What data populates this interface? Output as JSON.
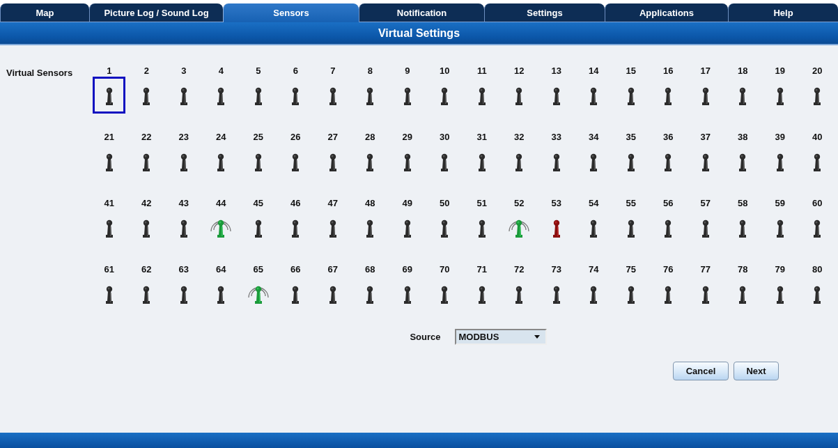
{
  "tabs": [
    {
      "label": "Map",
      "selected": false
    },
    {
      "label": "Picture Log / Sound Log",
      "selected": false
    },
    {
      "label": "Sensors",
      "selected": true
    },
    {
      "label": "Notification",
      "selected": false
    },
    {
      "label": "Settings",
      "selected": false
    },
    {
      "label": "Applications",
      "selected": false
    },
    {
      "label": "Help",
      "selected": false
    }
  ],
  "page_title": "Virtual Settings",
  "sensors_label": "Virtual Sensors",
  "sensors": [
    {
      "number": "1",
      "kind": "off",
      "selected": true
    },
    {
      "number": "2",
      "kind": "off",
      "selected": false
    },
    {
      "number": "3",
      "kind": "off",
      "selected": false
    },
    {
      "number": "4",
      "kind": "off",
      "selected": false
    },
    {
      "number": "5",
      "kind": "off",
      "selected": false
    },
    {
      "number": "6",
      "kind": "off",
      "selected": false
    },
    {
      "number": "7",
      "kind": "off",
      "selected": false
    },
    {
      "number": "8",
      "kind": "off",
      "selected": false
    },
    {
      "number": "9",
      "kind": "off",
      "selected": false
    },
    {
      "number": "10",
      "kind": "off",
      "selected": false
    },
    {
      "number": "11",
      "kind": "off",
      "selected": false
    },
    {
      "number": "12",
      "kind": "off",
      "selected": false
    },
    {
      "number": "13",
      "kind": "off",
      "selected": false
    },
    {
      "number": "14",
      "kind": "off",
      "selected": false
    },
    {
      "number": "15",
      "kind": "off",
      "selected": false
    },
    {
      "number": "16",
      "kind": "off",
      "selected": false
    },
    {
      "number": "17",
      "kind": "off",
      "selected": false
    },
    {
      "number": "18",
      "kind": "off",
      "selected": false
    },
    {
      "number": "19",
      "kind": "off",
      "selected": false
    },
    {
      "number": "20",
      "kind": "off",
      "selected": false
    },
    {
      "number": "21",
      "kind": "off",
      "selected": false
    },
    {
      "number": "22",
      "kind": "off",
      "selected": false
    },
    {
      "number": "23",
      "kind": "off",
      "selected": false
    },
    {
      "number": "24",
      "kind": "off",
      "selected": false
    },
    {
      "number": "25",
      "kind": "off",
      "selected": false
    },
    {
      "number": "26",
      "kind": "off",
      "selected": false
    },
    {
      "number": "27",
      "kind": "off",
      "selected": false
    },
    {
      "number": "28",
      "kind": "off",
      "selected": false
    },
    {
      "number": "29",
      "kind": "off",
      "selected": false
    },
    {
      "number": "30",
      "kind": "off",
      "selected": false
    },
    {
      "number": "31",
      "kind": "off",
      "selected": false
    },
    {
      "number": "32",
      "kind": "off",
      "selected": false
    },
    {
      "number": "33",
      "kind": "off",
      "selected": false
    },
    {
      "number": "34",
      "kind": "off",
      "selected": false
    },
    {
      "number": "35",
      "kind": "off",
      "selected": false
    },
    {
      "number": "36",
      "kind": "off",
      "selected": false
    },
    {
      "number": "37",
      "kind": "off",
      "selected": false
    },
    {
      "number": "38",
      "kind": "off",
      "selected": false
    },
    {
      "number": "39",
      "kind": "off",
      "selected": false
    },
    {
      "number": "40",
      "kind": "off",
      "selected": false
    },
    {
      "number": "41",
      "kind": "off",
      "selected": false
    },
    {
      "number": "42",
      "kind": "off",
      "selected": false
    },
    {
      "number": "43",
      "kind": "off",
      "selected": false
    },
    {
      "number": "44",
      "kind": "active",
      "selected": false
    },
    {
      "number": "45",
      "kind": "off",
      "selected": false
    },
    {
      "number": "46",
      "kind": "off",
      "selected": false
    },
    {
      "number": "47",
      "kind": "off",
      "selected": false
    },
    {
      "number": "48",
      "kind": "off",
      "selected": false
    },
    {
      "number": "49",
      "kind": "off",
      "selected": false
    },
    {
      "number": "50",
      "kind": "off",
      "selected": false
    },
    {
      "number": "51",
      "kind": "off",
      "selected": false
    },
    {
      "number": "52",
      "kind": "active",
      "selected": false
    },
    {
      "number": "53",
      "kind": "alarm",
      "selected": false
    },
    {
      "number": "54",
      "kind": "off",
      "selected": false
    },
    {
      "number": "55",
      "kind": "off",
      "selected": false
    },
    {
      "number": "56",
      "kind": "off",
      "selected": false
    },
    {
      "number": "57",
      "kind": "off",
      "selected": false
    },
    {
      "number": "58",
      "kind": "off",
      "selected": false
    },
    {
      "number": "59",
      "kind": "off",
      "selected": false
    },
    {
      "number": "60",
      "kind": "off",
      "selected": false
    },
    {
      "number": "61",
      "kind": "off",
      "selected": false
    },
    {
      "number": "62",
      "kind": "off",
      "selected": false
    },
    {
      "number": "63",
      "kind": "off",
      "selected": false
    },
    {
      "number": "64",
      "kind": "off",
      "selected": false
    },
    {
      "number": "65",
      "kind": "active",
      "selected": false
    },
    {
      "number": "66",
      "kind": "off",
      "selected": false
    },
    {
      "number": "67",
      "kind": "off",
      "selected": false
    },
    {
      "number": "68",
      "kind": "off",
      "selected": false
    },
    {
      "number": "69",
      "kind": "off",
      "selected": false
    },
    {
      "number": "70",
      "kind": "off",
      "selected": false
    },
    {
      "number": "71",
      "kind": "off",
      "selected": false
    },
    {
      "number": "72",
      "kind": "off",
      "selected": false
    },
    {
      "number": "73",
      "kind": "off",
      "selected": false
    },
    {
      "number": "74",
      "kind": "off",
      "selected": false
    },
    {
      "number": "75",
      "kind": "off",
      "selected": false
    },
    {
      "number": "76",
      "kind": "off",
      "selected": false
    },
    {
      "number": "77",
      "kind": "off",
      "selected": false
    },
    {
      "number": "78",
      "kind": "off",
      "selected": false
    },
    {
      "number": "79",
      "kind": "off",
      "selected": false
    },
    {
      "number": "80",
      "kind": "off",
      "selected": false
    }
  ],
  "source": {
    "label": "Source",
    "value": "MODBUS"
  },
  "buttons": [
    "Cancel",
    "Next"
  ]
}
